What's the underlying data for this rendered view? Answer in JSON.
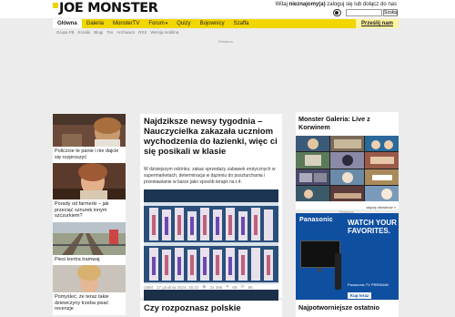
{
  "header": {
    "logo": "JOE MONSTER",
    "login_prefix": "Witaj ",
    "login_user": "nieznajomy(a)",
    "login_suffix": " zaloguj się lub dołącz do nas",
    "search_button": "Szukaj"
  },
  "nav": {
    "items": [
      {
        "label": "Główna"
      },
      {
        "label": "Galeria"
      },
      {
        "label": "MonsterTV"
      },
      {
        "label": "Forum"
      },
      {
        "label": "Quizy"
      },
      {
        "label": "Bojownicy"
      },
      {
        "label": "Szaffa"
      }
    ],
    "cta": "Prześlij nam"
  },
  "subnav": {
    "items": [
      "Grupa FB",
      "Kroniki",
      "Blogi",
      "Tos",
      "Archiwum",
      "RSS",
      "Wersja mobilna"
    ]
  },
  "ad_label": "Reklama",
  "left_column": [
    {
      "title": "Policzcie te panie i nie dajcie się rozproszyć"
    },
    {
      "title": "Porady od farmerki – jak przeciąć sznurek innym szczurkiem?"
    },
    {
      "title": "Piesi kontra tramwaj"
    },
    {
      "title": "Pomyśleć, że teraz takie dziewczyny trzeba pisać recenzje"
    }
  ],
  "main_article": {
    "title": "Najdziksze newsy tygodnia – Nauczycielka zakazała uczniom wychodzenia do łazienki, więc ci się posikali w klasie",
    "lead": "W dzisiejszym odcinku: zakaz sprzedaży zabawek erotycznych w supermarketach, determinacja w dążeniu do poszturchania i przestawianie w barze jako sposób terapii na t.4.",
    "meta": {
      "author": "UBM",
      "date": "17 grudnia 2024, 15:22",
      "views": "24 366",
      "likes": "69",
      "comments": "86"
    }
  },
  "second_article": {
    "title": "Czy rozpoznasz polskie"
  },
  "right_panel": {
    "title": "Monster Galeria: Live z Korwinem",
    "more_link": "więcej obrazków »"
  },
  "ad_box": {
    "label": "Reklama",
    "brand": "Panasonic",
    "headline": "WATCH YOUR FAVORITES.",
    "small": "Panasonic TV PREMIUM",
    "cta": "Kup teraz"
  },
  "bottom_right": {
    "title": "Najpotworniejsze ostatnio"
  },
  "colors": {
    "nav_yellow": "#f2d600",
    "ad_blue": "#0f4fa0",
    "page_bg": "#ececec"
  }
}
